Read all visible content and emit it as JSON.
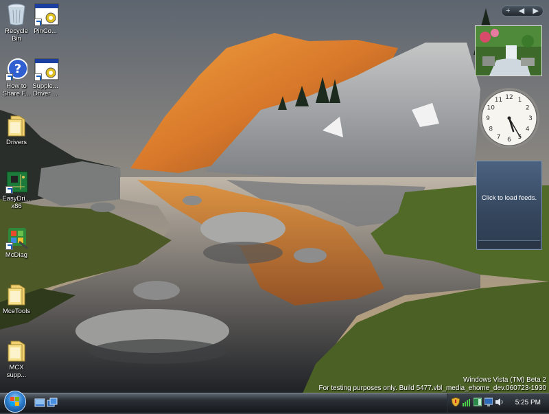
{
  "desktop_icons": [
    {
      "name": "recycle-bin",
      "label": "Recycle\nBin",
      "icon": "recycle-bin-icon"
    },
    {
      "name": "pinco",
      "label": "PinCo...",
      "icon": "window-shortcut-icon"
    },
    {
      "name": "how-to-share",
      "label": "How to\nShare F...",
      "icon": "help-icon"
    },
    {
      "name": "supplemental-driver",
      "label": "Supple...\nDriver ...",
      "icon": "window-shortcut-icon"
    },
    {
      "name": "drivers",
      "label": "Drivers",
      "icon": "folder-icon"
    },
    {
      "name": "easydriver",
      "label": "EasyDri...\nx86",
      "icon": "circuit-board-icon"
    },
    {
      "name": "mcdiag",
      "label": "McDiag",
      "icon": "diagnostic-icon"
    },
    {
      "name": "mcetools",
      "label": "MceTools",
      "icon": "folder-icon"
    },
    {
      "name": "mcx-support",
      "label": "MCX\nsupp...",
      "icon": "folder-icon"
    }
  ],
  "sidebar": {
    "controls": {
      "add": "+",
      "prev": "◀",
      "next": "▶"
    },
    "feed_gadget_text": "Click to load feeds.",
    "clock_gadget": {
      "hour": 5,
      "minute": 25
    }
  },
  "watermark": {
    "line1": "Windows Vista (TM) Beta 2",
    "line2": "For testing purposes only. Build 5477.vbl_media_ehome_dev.060723-1930"
  },
  "taskbar": {
    "start_icon": "windows-logo-icon",
    "quick_launch": [
      "show-desktop-icon",
      "switch-windows-icon"
    ],
    "tray_icons": [
      "security-shield-icon",
      "network-icon",
      "sidebar-icon",
      "monitor-icon",
      "volume-icon"
    ],
    "time": "5:25 PM"
  },
  "colors": {
    "taskbar": "#1c2025",
    "accent": "#2e7fd0",
    "feed_gadget": "#3a4d66"
  }
}
